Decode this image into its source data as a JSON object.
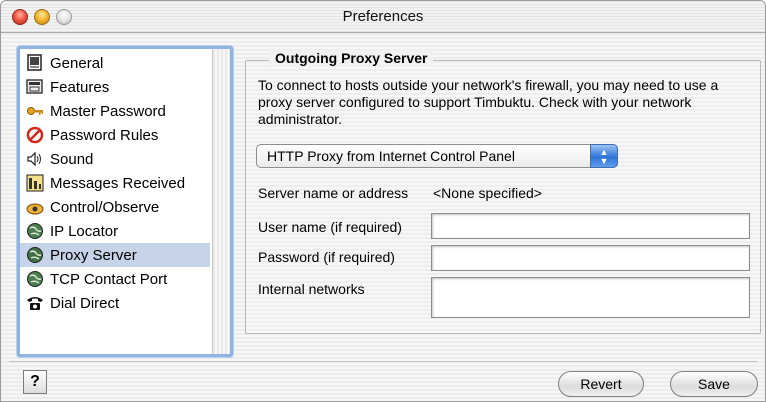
{
  "window": {
    "title": "Preferences"
  },
  "sidebar": {
    "items": [
      {
        "label": "General",
        "icon": "general-icon",
        "selected": false
      },
      {
        "label": "Features",
        "icon": "features-icon",
        "selected": false
      },
      {
        "label": "Master Password",
        "icon": "key-icon",
        "selected": false
      },
      {
        "label": "Password Rules",
        "icon": "prohibited-icon",
        "selected": false
      },
      {
        "label": "Sound",
        "icon": "speaker-icon",
        "selected": false
      },
      {
        "label": "Messages Received",
        "icon": "messages-icon",
        "selected": false
      },
      {
        "label": "Control/Observe",
        "icon": "eye-icon",
        "selected": false
      },
      {
        "label": "IP Locator",
        "icon": "globe-icon",
        "selected": false
      },
      {
        "label": "Proxy Server",
        "icon": "globe-icon",
        "selected": true
      },
      {
        "label": "TCP Contact Port",
        "icon": "globe-icon",
        "selected": false
      },
      {
        "label": "Dial Direct",
        "icon": "telephone-icon",
        "selected": false
      }
    ]
  },
  "panel": {
    "group_title": "Outgoing Proxy Server",
    "description": "To connect to hosts outside your network's firewall, you may need to use a proxy server configured to support Timbuktu.  Check with your network administrator.",
    "proxy_type_selected": "HTTP Proxy from Internet Control Panel",
    "server_label": "Server name or address",
    "server_value": "<None specified>",
    "username_label": "User name (if required)",
    "username_value": "",
    "password_label": "Password (if required)",
    "password_value": "",
    "internal_networks_label": "Internal networks",
    "internal_networks_value": ""
  },
  "footer": {
    "help_label": "?",
    "revert_label": "Revert",
    "save_label": "Save"
  },
  "colors": {
    "selection": "#c7d3e9",
    "focus_ring": "#8fb4df",
    "popup_accent": "#2f74d6"
  }
}
